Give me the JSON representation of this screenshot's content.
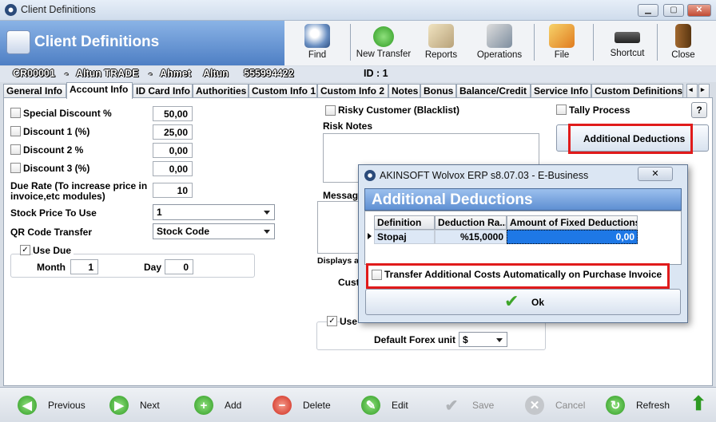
{
  "window": {
    "title": "Client Definitions",
    "min": "▁",
    "max": "▢",
    "close": "✕"
  },
  "header": {
    "title": "Client Definitions"
  },
  "toolbar": [
    {
      "label": "Find",
      "icon": "find-icon"
    },
    {
      "label": "New Transfer",
      "icon": "new-transfer-icon"
    },
    {
      "label": "Reports",
      "icon": "reports-icon"
    },
    {
      "label": "Operations",
      "icon": "operations-icon"
    },
    {
      "label": "File",
      "icon": "file-icon"
    },
    {
      "label": "Shortcut",
      "icon": "shortcut-icon"
    },
    {
      "label": "Close",
      "icon": "close-door-icon"
    }
  ],
  "client": {
    "code": "CR00001",
    "dash1": "-",
    "company": "Altun TRADE",
    "dash2": "-",
    "first": "Ahmet",
    "last": "Altun",
    "phone": "555994422",
    "id_label": "ID : 1"
  },
  "tabs": [
    "General Info",
    "Account Info",
    "ID Card Info",
    "Authorities",
    "Custom Info 1",
    "Custom Info 2",
    "Notes",
    "Bonus",
    "Balance/Credit",
    "Service Info",
    "Custom Definitions"
  ],
  "form": {
    "special_discount": {
      "label": "Special Discount %",
      "value": "50,00"
    },
    "discount1": {
      "label": "Discount 1 (%)",
      "value": "25,00"
    },
    "discount2": {
      "label": "Discount 2 %",
      "value": "0,00"
    },
    "discount3": {
      "label": "Discount 3 (%)",
      "value": "0,00"
    },
    "due_rate": {
      "label": "Due Rate (To increase price in invoice,etc modules)",
      "value": "10"
    },
    "stock_price": {
      "label": "Stock Price To Use",
      "value": "1"
    },
    "qr_code": {
      "label": "QR Code Transfer",
      "value": "Stock Code"
    },
    "use_due": {
      "label": "Use Due",
      "month_label": "Month",
      "month": "1",
      "day_label": "Day",
      "day": "0"
    },
    "risky": {
      "label": "Risky Customer (Blacklist)"
    },
    "risk_notes": {
      "label": "Risk Notes"
    },
    "message_label": "Messag",
    "displays_label": "Displays a",
    "cust_label": "Cust",
    "use_label": "Use",
    "default_forex": {
      "label": "Default Forex unit",
      "value": "$"
    },
    "tally": {
      "label": "Tally Process"
    },
    "help": "?",
    "additional_deductions_button": "Additional Deductions"
  },
  "dialog": {
    "title": "AKINSOFT Wolvox ERP s8.07.03 - E-Business",
    "close": "✕",
    "header": "Additional Deductions",
    "columns": [
      "Definition",
      "Deduction Ra...",
      "Amount of Fixed Deductions"
    ],
    "rows": [
      {
        "definition": "Stopaj",
        "rate": "%15,0000",
        "amount": "0,00"
      }
    ],
    "transfer_label": "Transfer Additional Costs Automatically on Purchase Invoice",
    "ok": "Ok"
  },
  "nav": [
    {
      "label": "Previous",
      "icon": "previous-icon",
      "glyph": "◀"
    },
    {
      "label": "Next",
      "icon": "next-icon",
      "glyph": "▶"
    },
    {
      "label": "Add",
      "icon": "add-icon",
      "glyph": "+"
    },
    {
      "label": "Delete",
      "icon": "delete-icon",
      "glyph": "−"
    },
    {
      "label": "Edit",
      "icon": "edit-icon",
      "glyph": "✎"
    },
    {
      "label": "Save",
      "icon": "save-icon",
      "glyph": "✔"
    },
    {
      "label": "Cancel",
      "icon": "cancel-icon",
      "glyph": "✕"
    },
    {
      "label": "Refresh",
      "icon": "refresh-icon",
      "glyph": "↻"
    }
  ],
  "colors": {
    "accent": "#4e7fc4",
    "highlight": "#e01b1b",
    "selection": "#1e78e6"
  }
}
